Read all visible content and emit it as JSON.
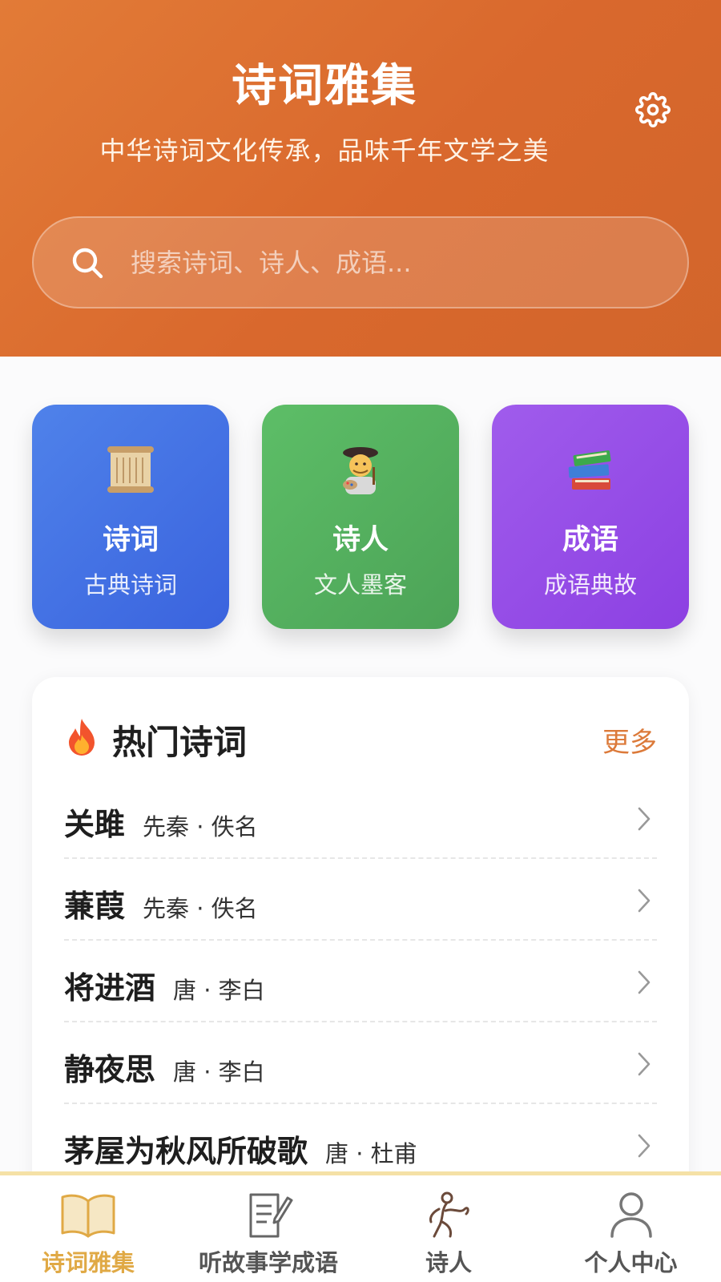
{
  "header": {
    "title": "诗词雅集",
    "subtitle": "中华诗词文化传承，品味千年文学之美",
    "settings_icon": "gear-icon",
    "gradient": [
      "#e27b37",
      "#d2652b"
    ]
  },
  "search": {
    "icon": "search-icon",
    "placeholder": "搜索诗词、诗人、成语..."
  },
  "categories": [
    {
      "title": "诗词",
      "subtitle": "古典诗词",
      "icon": "scroll-icon",
      "color": "#4773e6"
    },
    {
      "title": "诗人",
      "subtitle": "文人墨客",
      "icon": "artist-icon",
      "color": "#55b160"
    },
    {
      "title": "成语",
      "subtitle": "成语典故",
      "icon": "books-icon",
      "color": "#9550e8"
    }
  ],
  "hot": {
    "icon": "fire-icon",
    "title": "热门诗词",
    "more": "更多",
    "more_color": "#dc7a3a",
    "items": [
      {
        "title": "关雎",
        "meta": "先秦 · 佚名"
      },
      {
        "title": "蒹葭",
        "meta": "先秦 · 佚名"
      },
      {
        "title": "将进酒",
        "meta": "唐 · 李白"
      },
      {
        "title": "静夜思",
        "meta": "唐 · 李白"
      },
      {
        "title": "茅屋为秋风所破歌",
        "meta": "唐 · 杜甫"
      }
    ]
  },
  "tabbar": {
    "active_color": "#e0a945",
    "tabs": [
      {
        "label": "诗词雅集",
        "icon": "open-book-icon",
        "active": true
      },
      {
        "label": "听故事学成语",
        "icon": "notepad-pen-icon",
        "active": false
      },
      {
        "label": "诗人",
        "icon": "poet-figure-icon",
        "active": false
      },
      {
        "label": "个人中心",
        "icon": "user-icon",
        "active": false
      }
    ]
  }
}
